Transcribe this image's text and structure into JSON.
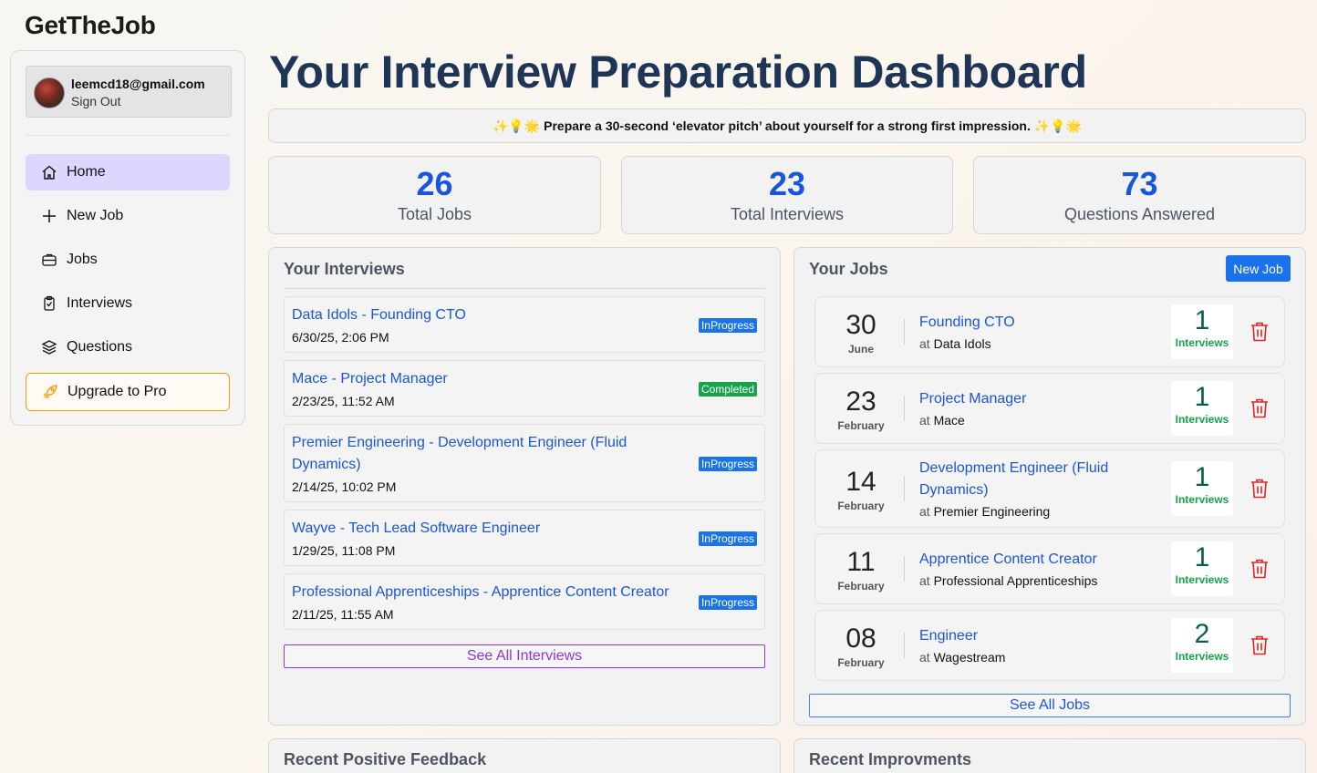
{
  "app": {
    "brand": "GetTheJob"
  },
  "sidebar": {
    "user": {
      "email": "leemcd18@gmail.com",
      "sign_out": "Sign Out"
    },
    "nav": {
      "home": "Home",
      "new_job": "New Job",
      "jobs": "Jobs",
      "interviews": "Interviews",
      "questions": "Questions",
      "upgrade": "Upgrade to Pro"
    }
  },
  "main": {
    "title": "Your Interview Preparation Dashboard",
    "tip": "✨💡🌟 Prepare a 30-second ‘elevator pitch’ about yourself for a strong first impression. ✨💡🌟",
    "stats": [
      {
        "value": "26",
        "label": "Total Jobs"
      },
      {
        "value": "23",
        "label": "Total Interviews"
      },
      {
        "value": "73",
        "label": "Questions Answered"
      }
    ]
  },
  "interviews_panel": {
    "title": "Your Interviews",
    "items": [
      {
        "title": "Data Idols - Founding CTO",
        "date": "6/30/25, 2:06 PM",
        "status": "InProgress"
      },
      {
        "title": "Mace - Project Manager",
        "date": "2/23/25, 11:52 AM",
        "status": "Completed"
      },
      {
        "title": "Premier Engineering - Development Engineer (Fluid Dynamics)",
        "date": "2/14/25, 10:02 PM",
        "status": "InProgress"
      },
      {
        "title": "Wayve - Tech Lead Software Engineer",
        "date": "1/29/25, 11:08 PM",
        "status": "InProgress"
      },
      {
        "title": "Professional Apprenticeships - Apprentice Content Creator",
        "date": "2/11/25, 11:55 AM",
        "status": "InProgress"
      }
    ],
    "see_all": "See All Interviews"
  },
  "jobs_panel": {
    "title": "Your Jobs",
    "new_job": "New Job",
    "items": [
      {
        "day": "30",
        "month": "June",
        "role": "Founding CTO",
        "at": "at",
        "company": "Data Idols",
        "count": "1",
        "count_label": "Interviews"
      },
      {
        "day": "23",
        "month": "February",
        "role": "Project Manager",
        "at": "at",
        "company": "Mace",
        "count": "1",
        "count_label": "Interviews"
      },
      {
        "day": "14",
        "month": "February",
        "role": "Development Engineer (Fluid Dynamics)",
        "at": "at",
        "company": "Premier Engineering",
        "count": "1",
        "count_label": "Interviews"
      },
      {
        "day": "11",
        "month": "February",
        "role": "Apprentice Content Creator",
        "at": "at",
        "company": "Professional Apprenticeships",
        "count": "1",
        "count_label": "Interviews"
      },
      {
        "day": "08",
        "month": "February",
        "role": "Engineer",
        "at": "at",
        "company": "Wagestream",
        "count": "2",
        "count_label": "Interviews"
      }
    ],
    "see_all": "See All Jobs"
  },
  "feedback_panel": {
    "title": "Recent Positive Feedback"
  },
  "improvements_panel": {
    "title": "Recent Improvments"
  },
  "colors": {
    "accent_blue": "#1a56db",
    "button_blue": "#1a73e8",
    "inprogress": "#1a73e8",
    "completed": "#16a34a",
    "active_nav": "#ddd6fe",
    "pro_border": "#f59e0b",
    "see_all_interviews": "#9333ea",
    "trash": "#dc2626"
  }
}
